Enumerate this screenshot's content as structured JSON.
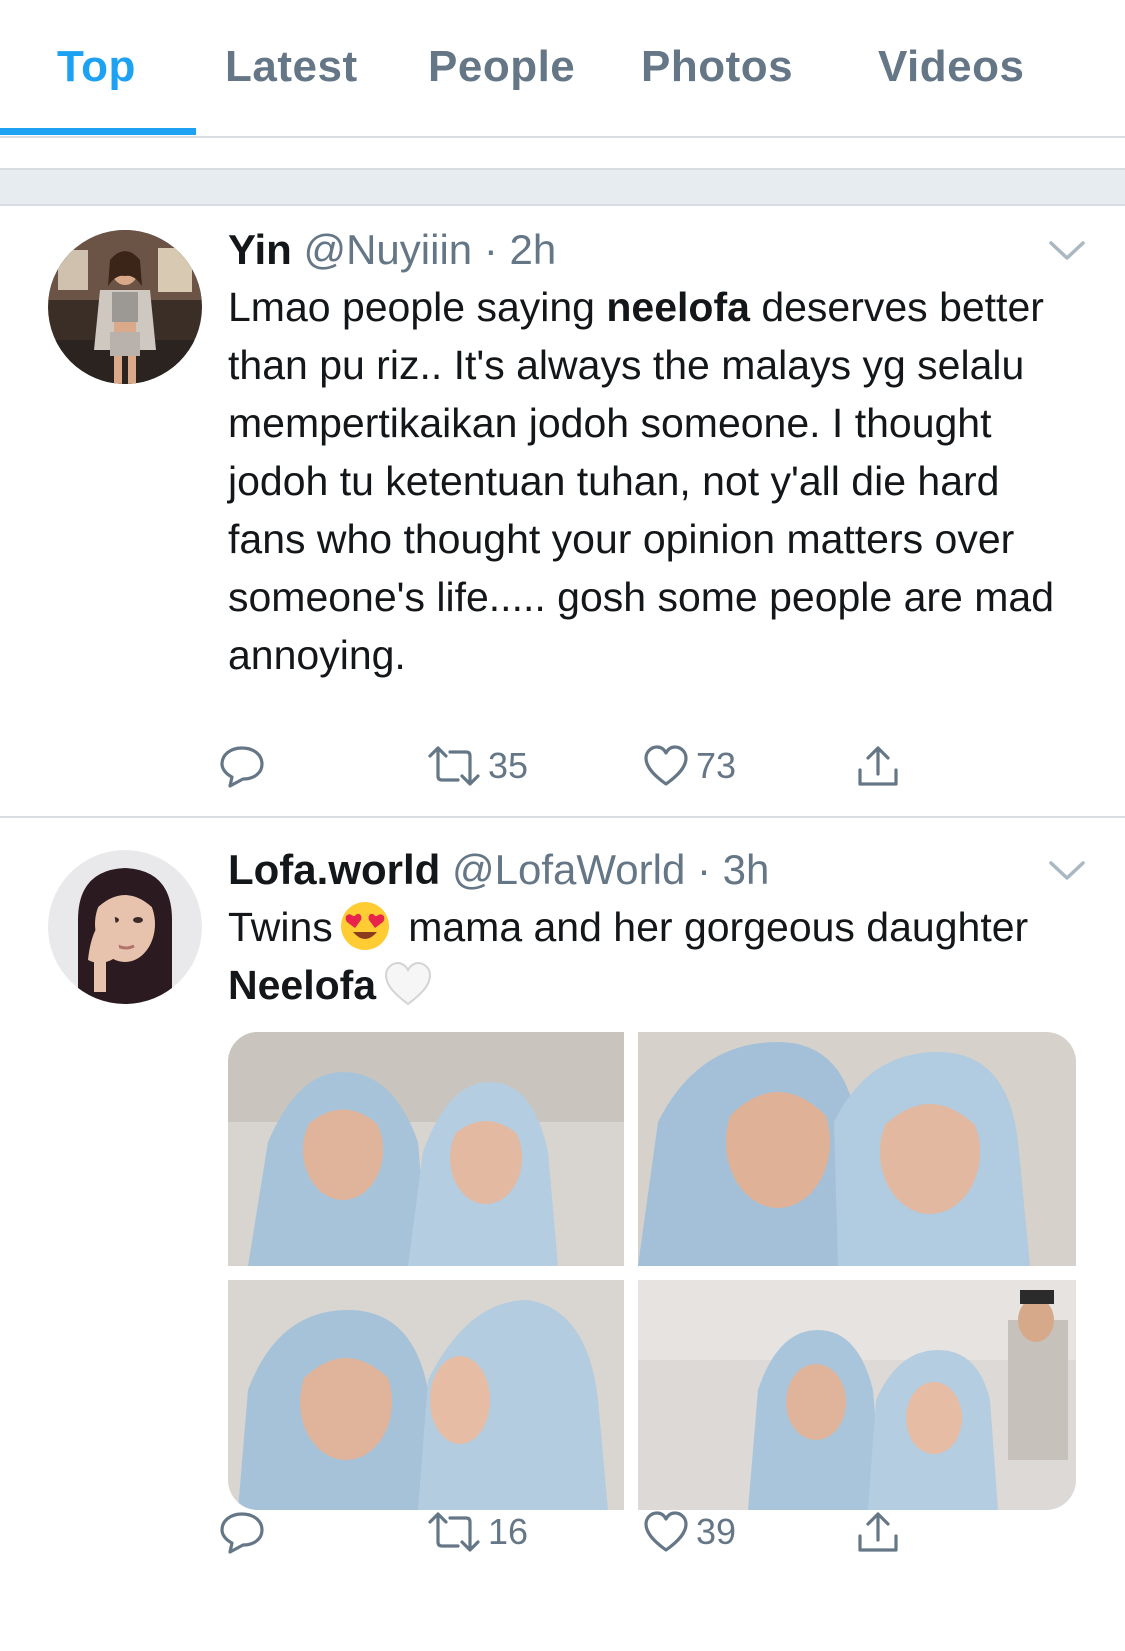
{
  "tabs": [
    {
      "label": "Top",
      "active": true
    },
    {
      "label": "Latest",
      "active": false
    },
    {
      "label": "People",
      "active": false
    },
    {
      "label": "Photos",
      "active": false
    },
    {
      "label": "Videos",
      "active": false
    }
  ],
  "colors": {
    "accent": "#1da1f2",
    "secondary_text": "#657786",
    "divider": "#d9dde1",
    "band": "#e6ecf0"
  },
  "tweets": [
    {
      "name": "Yin",
      "handle": "@Nuyiiin",
      "dot": "·",
      "time": "2h",
      "text_before": "Lmao people saying ",
      "text_bold": "neelofa",
      "text_after": " deserves better than pu riz.. It's always the malays yg selalu mempertikaikan jodoh someone. I thought jodoh tu ketentuan tuhan, not y'all die hard fans who thought your opinion matters over someone's life..... gosh some people are mad annoying.",
      "retweets": "35",
      "likes": "73",
      "avatar_icon": "profile-photo-woman"
    },
    {
      "name": "Lofa.world",
      "handle": "@LofaWorld",
      "dot": "·",
      "time": "3h",
      "text_1": "Twins",
      "emoji_1": "heart-eyes-emoji",
      "text_2": " mama and her gorgeous daughter ",
      "text_bold": "Neelofa",
      "emoji_2": "white-heart-emoji",
      "retweets": "16",
      "likes": "39",
      "avatar_icon": "profile-photo-woman-hijab",
      "photos": [
        "photo-mother-daughter-1",
        "photo-mother-daughter-2",
        "photo-mother-daughter-3",
        "photo-mother-daughter-4"
      ]
    }
  ]
}
